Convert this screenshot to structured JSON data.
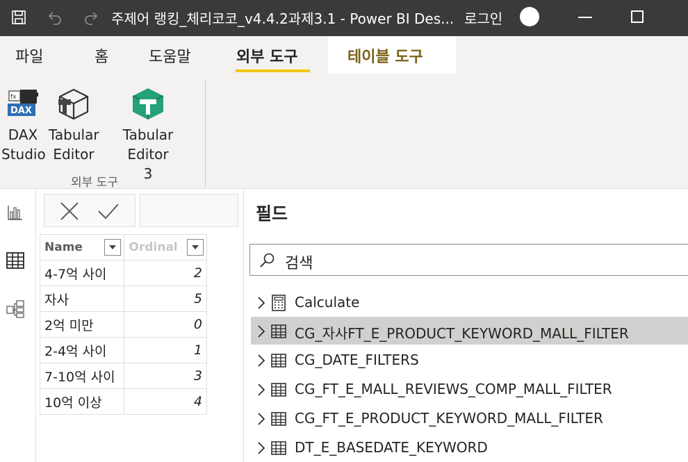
{
  "titlebar": {
    "title": "주제어 랭킹_체리코코_v4.4.2과제3.1 - Power BI Des...",
    "login": "로그인"
  },
  "tabs": [
    {
      "label": "파일"
    },
    {
      "label": "홈"
    },
    {
      "label": "도움말"
    },
    {
      "label": "외부 도구",
      "active": true
    },
    {
      "label": "테이블 도구",
      "contextual": true
    }
  ],
  "ribbon": {
    "buttons": [
      {
        "line1": "DAX",
        "line2": "Studio",
        "icon": "dax-studio-icon"
      },
      {
        "line1": "Tabular",
        "line2": "Editor",
        "icon": "tabular-editor-icon"
      },
      {
        "line1": "Tabular Editor",
        "line2": "3",
        "icon": "tabular-editor-3-icon"
      }
    ],
    "group_label": "외부 도구"
  },
  "table": {
    "columns": [
      {
        "label": "Name"
      },
      {
        "label": "Ordinal"
      }
    ],
    "rows": [
      {
        "name": "4-7억 사이",
        "ordinal": "2"
      },
      {
        "name": "자사",
        "ordinal": "5"
      },
      {
        "name": "2억 미만",
        "ordinal": "0"
      },
      {
        "name": "2-4억 사이",
        "ordinal": "1"
      },
      {
        "name": "7-10억 사이",
        "ordinal": "3"
      },
      {
        "name": "10억 이상",
        "ordinal": "4"
      }
    ]
  },
  "fields": {
    "title": "필드",
    "search_placeholder": "검색",
    "items": [
      {
        "label": "Calculate",
        "icon": "calculator-icon",
        "selected": false
      },
      {
        "label": "CG_자사FT_E_PRODUCT_KEYWORD_MALL_FILTER",
        "icon": "table-icon",
        "selected": true
      },
      {
        "label": "CG_DATE_FILTERS",
        "icon": "table-icon",
        "selected": false
      },
      {
        "label": "CG_FT_E_MALL_REVIEWS_COMP_MALL_FILTER",
        "icon": "table-icon",
        "selected": false
      },
      {
        "label": "CG_FT_E_PRODUCT_KEYWORD_MALL_FILTER",
        "icon": "table-icon",
        "selected": false
      },
      {
        "label": "DT_E_BASEDATE_KEYWORD",
        "icon": "table-icon",
        "selected": false
      }
    ]
  },
  "colors": {
    "titlebar_bg": "#3b3a39",
    "accent_underline": "#f2c811",
    "contextual_tab_text": "#7a6116",
    "selected_row_bg": "#d2d0ce"
  }
}
